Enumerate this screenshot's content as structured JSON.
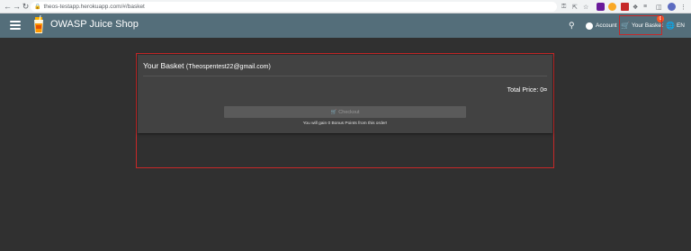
{
  "browser": {
    "url": "theos-testapp.herokuapp.com/#/basket"
  },
  "toolbar": {
    "title": "OWASP Juice Shop",
    "account_label": "Account",
    "basket_label": "Your Basket",
    "basket_count": "0",
    "language_label": "EN"
  },
  "basket": {
    "heading": "Your Basket",
    "email": "(Theospentest22@gmail.com)",
    "total_price": "Total Price: 0¤",
    "checkout_label": "Checkout",
    "bonus_text": "You will gain 0 Bonus Points from this order!"
  },
  "colors": {
    "toolbar": "#546e7a",
    "background": "#303030",
    "card": "#424242",
    "highlight": "#c62828",
    "badge": "#ff5722"
  }
}
